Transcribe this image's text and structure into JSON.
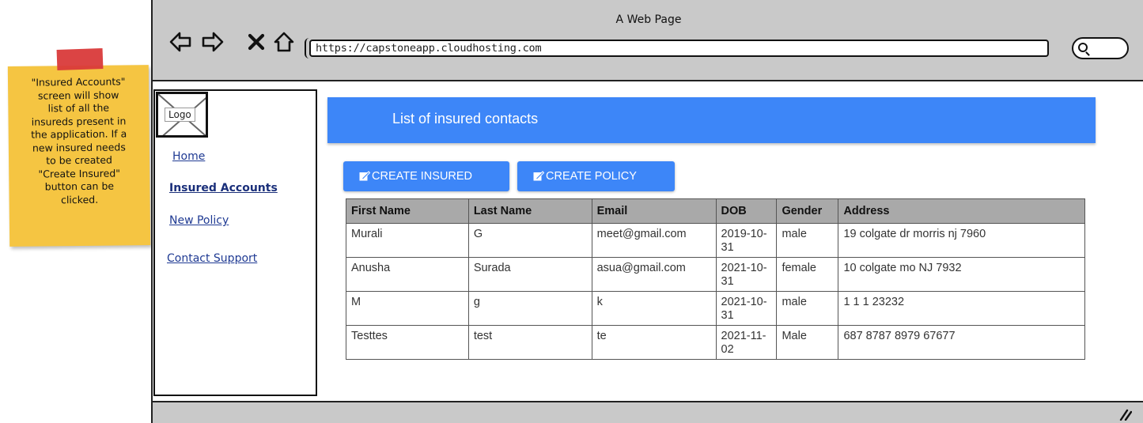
{
  "note": {
    "text": "\"Insured Accounts\"\nscreen will show\nlist of all the\ninsureds present in\nthe application. If a\nnew insured needs\nto be created\n\"Create Insured\"\nbutton can be\nclicked.",
    "color": "#f5c542",
    "tape_color": "#d93a3a"
  },
  "browser": {
    "title": "A Web Page",
    "url": "https://capstoneapp.cloudhosting.com",
    "nav_icons": [
      "back-arrow-icon",
      "forward-arrow-icon",
      "close-x-icon",
      "home-icon"
    ],
    "search_icon": "search-icon",
    "resize_icon": "resize-grip-icon"
  },
  "sidebar": {
    "logo_label": "Logo",
    "items": [
      {
        "label": "Home"
      },
      {
        "label": "Insured Accounts",
        "active": true
      },
      {
        "label": "New Policy"
      },
      {
        "label": "Contact Support"
      }
    ]
  },
  "header": {
    "title": "List of insured contacts",
    "color": "#3d86f8"
  },
  "buttons": {
    "create_insured": "CREATE INSURED",
    "create_policy": "CREATE POLICY",
    "icon": "edit-icon"
  },
  "table": {
    "columns": [
      "First Name",
      "Last Name",
      "Email",
      "DOB",
      "Gender",
      "Address"
    ],
    "rows": [
      [
        "Murali",
        "G",
        "meet@gmail.com",
        "2019-10-31",
        "male",
        "19 colgate dr morris nj 7960"
      ],
      [
        "Anusha",
        "Surada",
        "asua@gmail.com",
        "2021-10-31",
        "female",
        "10 colgate mo NJ 7932"
      ],
      [
        "M",
        "g",
        "k",
        "2021-10-31",
        "male",
        "1 1 1 23232"
      ],
      [
        "Testtes",
        "test",
        "te",
        "2021-11-02",
        "Male",
        "687 8787 8979 67677"
      ]
    ]
  }
}
